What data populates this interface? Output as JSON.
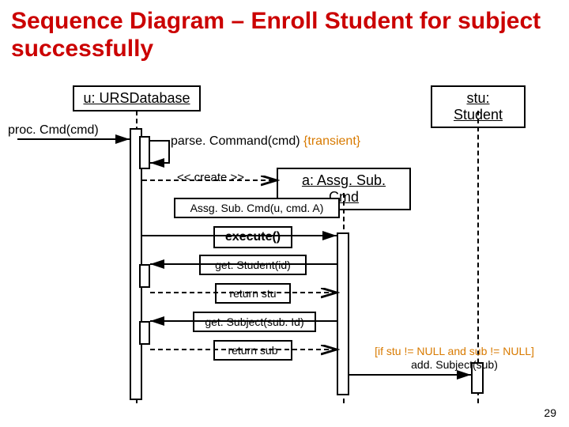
{
  "title": "Sequence Diagram – Enroll Student for subject successfully",
  "lifelines": {
    "u": "u: URSDatabase",
    "stu": "stu: Student",
    "a": "a: Assg. Sub. Cmd"
  },
  "messages": {
    "procCmd": "proc. Cmd(cmd)",
    "parseCommand": "parse. Command(cmd)",
    "transient": " {transient}",
    "create": "<< create >>",
    "ctor": "Assg. Sub. Cmd(u, cmd. A)",
    "execute": "execute()",
    "getStudent": "get. Student(id)",
    "returnStu": "return stu",
    "getSubject": "get. Subject(sub. Id)",
    "returnSub": "return sub",
    "guard_line1": "[if stu != NULL and sub != NULL]",
    "guard_line2": "add. Subject(sub)"
  },
  "pageNumber": "29",
  "chart_data": {
    "type": "sequence-diagram",
    "title": "Sequence Diagram – Enroll Student for subject successfully",
    "participants": [
      {
        "id": "u",
        "label": "u: URSDatabase"
      },
      {
        "id": "stu",
        "label": "stu: Student"
      },
      {
        "id": "a",
        "label": "a: Assg. Sub. Cmd",
        "createdBy": "u"
      }
    ],
    "messages": [
      {
        "from": "external",
        "to": "u",
        "label": "proc. Cmd(cmd)",
        "kind": "sync"
      },
      {
        "from": "u",
        "to": "u",
        "label": "parse. Command(cmd) {transient}",
        "kind": "self"
      },
      {
        "from": "u",
        "to": "a",
        "label": "<< create >>",
        "kind": "create"
      },
      {
        "from": "a",
        "to": "a",
        "label": "Assg. Sub. Cmd(u, cmd. A)",
        "kind": "constructor-self"
      },
      {
        "from": "u",
        "to": "a",
        "label": "execute()",
        "kind": "sync"
      },
      {
        "from": "a",
        "to": "u",
        "label": "get. Student(id)",
        "kind": "sync"
      },
      {
        "from": "u",
        "to": "a",
        "label": "return stu",
        "kind": "return"
      },
      {
        "from": "a",
        "to": "u",
        "label": "get. Subject(sub. Id)",
        "kind": "sync"
      },
      {
        "from": "u",
        "to": "a",
        "label": "return sub",
        "kind": "return"
      },
      {
        "from": "a",
        "to": "stu",
        "label": "add. Subject(sub)",
        "guard": "[if stu != NULL and sub != NULL]",
        "kind": "sync"
      }
    ]
  }
}
